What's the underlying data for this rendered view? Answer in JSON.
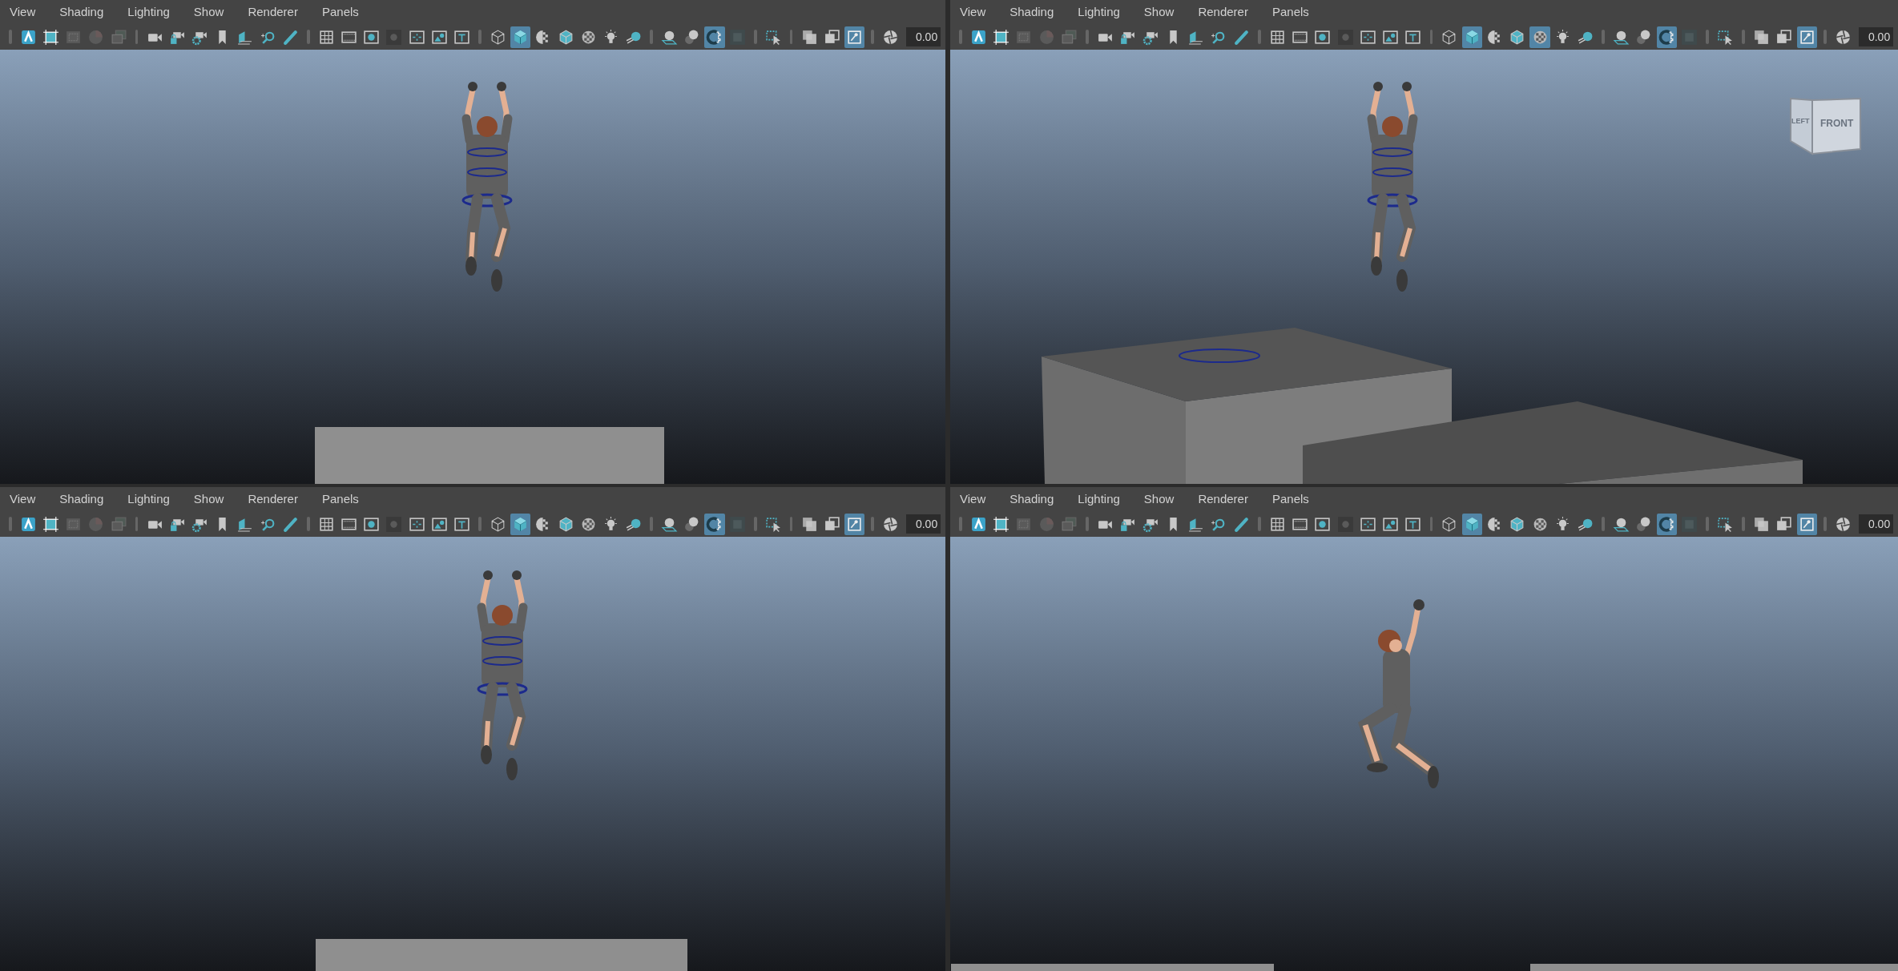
{
  "panels": [
    {
      "menu": [
        "View",
        "Shading",
        "Lighting",
        "Show",
        "Renderer",
        "Panels"
      ],
      "toolbar": [
        [
          {
            "kind": "logo",
            "selected": false
          },
          {
            "kind": "gate",
            "selected": false
          },
          {
            "kind": "bookmarkbox",
            "selected": false
          },
          {
            "kind": "colorball",
            "selected": false
          },
          {
            "kind": "imagestack",
            "selected": false
          }
        ],
        [
          {
            "kind": "camera",
            "selected": false
          },
          {
            "kind": "lockcam",
            "selected": false
          },
          {
            "kind": "gearcam",
            "selected": false
          },
          {
            "kind": "bookmark",
            "selected": false
          },
          {
            "kind": "plane",
            "selected": false
          },
          {
            "kind": "zoom",
            "selected": false
          },
          {
            "kind": "pencil",
            "selected": false
          }
        ],
        [
          {
            "kind": "grid",
            "selected": false
          },
          {
            "kind": "filmgate",
            "selected": false
          },
          {
            "kind": "resgate",
            "selected": false
          },
          {
            "kind": "gatemask",
            "selected": false
          },
          {
            "kind": "fieldchart",
            "selected": false
          },
          {
            "kind": "safeaction",
            "selected": false
          },
          {
            "kind": "title",
            "selected": false
          }
        ],
        [
          {
            "kind": "wireframe",
            "selected": false
          },
          {
            "kind": "shaded",
            "selected": true
          },
          {
            "kind": "halfshade",
            "selected": false
          },
          {
            "kind": "wireshaded",
            "selected": false
          },
          {
            "kind": "checker",
            "selected": false
          },
          {
            "kind": "light",
            "selected": false
          },
          {
            "kind": "shadow",
            "selected": false
          }
        ],
        [
          {
            "kind": "occlusion",
            "selected": false
          },
          {
            "kind": "blur",
            "selected": false
          },
          {
            "kind": "antialias",
            "selected": true
          },
          {
            "kind": "square",
            "selected": false
          }
        ],
        [
          {
            "kind": "isolate",
            "selected": false
          }
        ],
        [
          {
            "kind": "xray",
            "selected": false
          },
          {
            "kind": "xrayjoint",
            "selected": false
          },
          {
            "kind": "xrayactive",
            "selected": true
          }
        ],
        [
          {
            "kind": "aperture",
            "selected": false
          }
        ]
      ],
      "field": "0.00"
    },
    {
      "menu": [
        "View",
        "Shading",
        "Lighting",
        "Show",
        "Renderer",
        "Panels"
      ],
      "toolbar": [
        [
          {
            "kind": "logo",
            "selected": false
          },
          {
            "kind": "gate",
            "selected": false
          },
          {
            "kind": "bookmarkbox",
            "selected": false
          },
          {
            "kind": "colorball",
            "selected": false
          },
          {
            "kind": "imagestack",
            "selected": false
          }
        ],
        [
          {
            "kind": "camera",
            "selected": false
          },
          {
            "kind": "lockcam",
            "selected": false
          },
          {
            "kind": "gearcam",
            "selected": false
          },
          {
            "kind": "bookmark",
            "selected": false
          },
          {
            "kind": "plane",
            "selected": false
          },
          {
            "kind": "zoom",
            "selected": false
          },
          {
            "kind": "pencil",
            "selected": false
          }
        ],
        [
          {
            "kind": "grid",
            "selected": false
          },
          {
            "kind": "filmgate",
            "selected": false
          },
          {
            "kind": "resgate",
            "selected": false
          },
          {
            "kind": "gatemask",
            "selected": false
          },
          {
            "kind": "fieldchart",
            "selected": false
          },
          {
            "kind": "safeaction",
            "selected": false
          },
          {
            "kind": "title",
            "selected": false
          }
        ],
        [
          {
            "kind": "wireframe",
            "selected": false
          },
          {
            "kind": "shaded",
            "selected": true
          },
          {
            "kind": "halfshade",
            "selected": false
          },
          {
            "kind": "wireshaded",
            "selected": false
          },
          {
            "kind": "checker",
            "selected": true
          },
          {
            "kind": "light",
            "selected": false
          },
          {
            "kind": "shadow",
            "selected": false
          }
        ],
        [
          {
            "kind": "occlusion",
            "selected": false
          },
          {
            "kind": "blur",
            "selected": false
          },
          {
            "kind": "antialias",
            "selected": true
          },
          {
            "kind": "square",
            "selected": false
          }
        ],
        [
          {
            "kind": "isolate",
            "selected": false
          }
        ],
        [
          {
            "kind": "xray",
            "selected": false
          },
          {
            "kind": "xrayjoint",
            "selected": false
          },
          {
            "kind": "xrayactive",
            "selected": true
          }
        ],
        [
          {
            "kind": "aperture",
            "selected": false
          }
        ]
      ],
      "field": "0.00",
      "view_cube": {
        "left": "LEFT",
        "front": "FRONT"
      }
    },
    {
      "menu": [
        "View",
        "Shading",
        "Lighting",
        "Show",
        "Renderer",
        "Panels"
      ],
      "toolbar": [
        [
          {
            "kind": "logo",
            "selected": false
          },
          {
            "kind": "gate",
            "selected": false
          },
          {
            "kind": "bookmarkbox",
            "selected": false
          },
          {
            "kind": "colorball",
            "selected": false
          },
          {
            "kind": "imagestack",
            "selected": false
          }
        ],
        [
          {
            "kind": "camera",
            "selected": false
          },
          {
            "kind": "lockcam",
            "selected": false
          },
          {
            "kind": "gearcam",
            "selected": false
          },
          {
            "kind": "bookmark",
            "selected": false
          },
          {
            "kind": "plane",
            "selected": false
          },
          {
            "kind": "zoom",
            "selected": false
          },
          {
            "kind": "pencil",
            "selected": false
          }
        ],
        [
          {
            "kind": "grid",
            "selected": false
          },
          {
            "kind": "filmgate",
            "selected": false
          },
          {
            "kind": "resgate",
            "selected": false
          },
          {
            "kind": "gatemask",
            "selected": false
          },
          {
            "kind": "fieldchart",
            "selected": false
          },
          {
            "kind": "safeaction",
            "selected": false
          },
          {
            "kind": "title",
            "selected": false
          }
        ],
        [
          {
            "kind": "wireframe",
            "selected": false
          },
          {
            "kind": "shaded",
            "selected": true
          },
          {
            "kind": "halfshade",
            "selected": false
          },
          {
            "kind": "wireshaded",
            "selected": false
          },
          {
            "kind": "checker",
            "selected": false
          },
          {
            "kind": "light",
            "selected": false
          },
          {
            "kind": "shadow",
            "selected": false
          }
        ],
        [
          {
            "kind": "occlusion",
            "selected": false
          },
          {
            "kind": "blur",
            "selected": false
          },
          {
            "kind": "antialias",
            "selected": true
          },
          {
            "kind": "square",
            "selected": false
          }
        ],
        [
          {
            "kind": "isolate",
            "selected": false
          }
        ],
        [
          {
            "kind": "xray",
            "selected": false
          },
          {
            "kind": "xrayjoint",
            "selected": false
          },
          {
            "kind": "xrayactive",
            "selected": true
          }
        ],
        [
          {
            "kind": "aperture",
            "selected": false
          }
        ]
      ],
      "field": "0.00"
    },
    {
      "menu": [
        "View",
        "Shading",
        "Lighting",
        "Show",
        "Renderer",
        "Panels"
      ],
      "toolbar": [
        [
          {
            "kind": "logo",
            "selected": false
          },
          {
            "kind": "gate",
            "selected": false
          },
          {
            "kind": "bookmarkbox",
            "selected": false
          },
          {
            "kind": "colorball",
            "selected": false
          },
          {
            "kind": "imagestack",
            "selected": false
          }
        ],
        [
          {
            "kind": "camera",
            "selected": false
          },
          {
            "kind": "lockcam",
            "selected": false
          },
          {
            "kind": "gearcam",
            "selected": false
          },
          {
            "kind": "bookmark",
            "selected": false
          },
          {
            "kind": "plane",
            "selected": false
          },
          {
            "kind": "zoom",
            "selected": false
          },
          {
            "kind": "pencil",
            "selected": false
          }
        ],
        [
          {
            "kind": "grid",
            "selected": false
          },
          {
            "kind": "filmgate",
            "selected": false
          },
          {
            "kind": "resgate",
            "selected": false
          },
          {
            "kind": "gatemask",
            "selected": false
          },
          {
            "kind": "fieldchart",
            "selected": false
          },
          {
            "kind": "safeaction",
            "selected": false
          },
          {
            "kind": "title",
            "selected": false
          }
        ],
        [
          {
            "kind": "wireframe",
            "selected": false
          },
          {
            "kind": "shaded",
            "selected": true
          },
          {
            "kind": "halfshade",
            "selected": false
          },
          {
            "kind": "wireshaded",
            "selected": false
          },
          {
            "kind": "checker",
            "selected": false
          },
          {
            "kind": "light",
            "selected": false
          },
          {
            "kind": "shadow",
            "selected": false
          }
        ],
        [
          {
            "kind": "occlusion",
            "selected": false
          },
          {
            "kind": "blur",
            "selected": false
          },
          {
            "kind": "antialias",
            "selected": true
          },
          {
            "kind": "square",
            "selected": false
          }
        ],
        [
          {
            "kind": "isolate",
            "selected": false
          }
        ],
        [
          {
            "kind": "xray",
            "selected": false
          },
          {
            "kind": "xrayjoint",
            "selected": false
          },
          {
            "kind": "xrayactive",
            "selected": true
          }
        ],
        [
          {
            "kind": "aperture",
            "selected": false
          }
        ]
      ],
      "field": "0.00"
    }
  ]
}
